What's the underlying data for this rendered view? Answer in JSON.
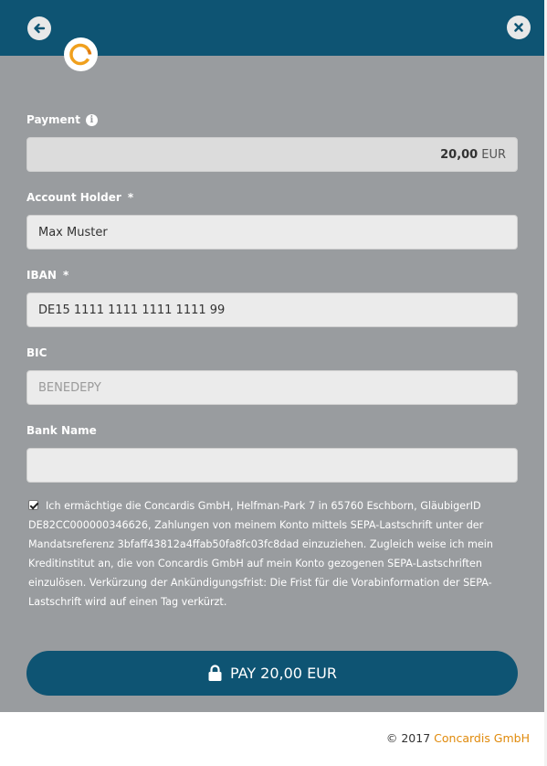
{
  "payment": {
    "label": "Payment",
    "amount": "20,00",
    "currency": "EUR"
  },
  "account_holder": {
    "label": "Account Holder",
    "required": "*",
    "value": "Max Muster"
  },
  "iban": {
    "label": "IBAN",
    "required": "*",
    "value": "DE15 1111 1111 1111 1111 99"
  },
  "bic": {
    "label": "BIC",
    "placeholder": "BENEDEPY"
  },
  "bank_name": {
    "label": "Bank Name",
    "value": ""
  },
  "mandate": {
    "checked": true,
    "text": "Ich ermächtige die Concardis GmbH, Helfman-Park 7 in 65760 Eschborn, GläubigerID DE82CC000000346626, Zahlungen von meinem Konto mittels SEPA-Lastschrift unter der Mandatsreferenz 3bfaff43812a4ffab50fa8fc03fc8dad einzuziehen. Zugleich weise ich mein Kreditinstitut an, die von Concardis GmbH auf mein Konto gezogenen SEPA-Lastschriften einzulösen. Verkürzung der Ankündigungsfrist: Die Frist für die Vorabinformation der SEPA-Lastschrift wird auf einen Tag verkürzt."
  },
  "pay_button": {
    "label": "PAY 20,00 EUR",
    "icon": "lock-icon"
  },
  "footer": {
    "copyright": "© 2017",
    "brand": "Concardis GmbH"
  },
  "colors": {
    "header": "#0e5473",
    "panel": "#999c9f",
    "brand": "#e08a0b"
  }
}
